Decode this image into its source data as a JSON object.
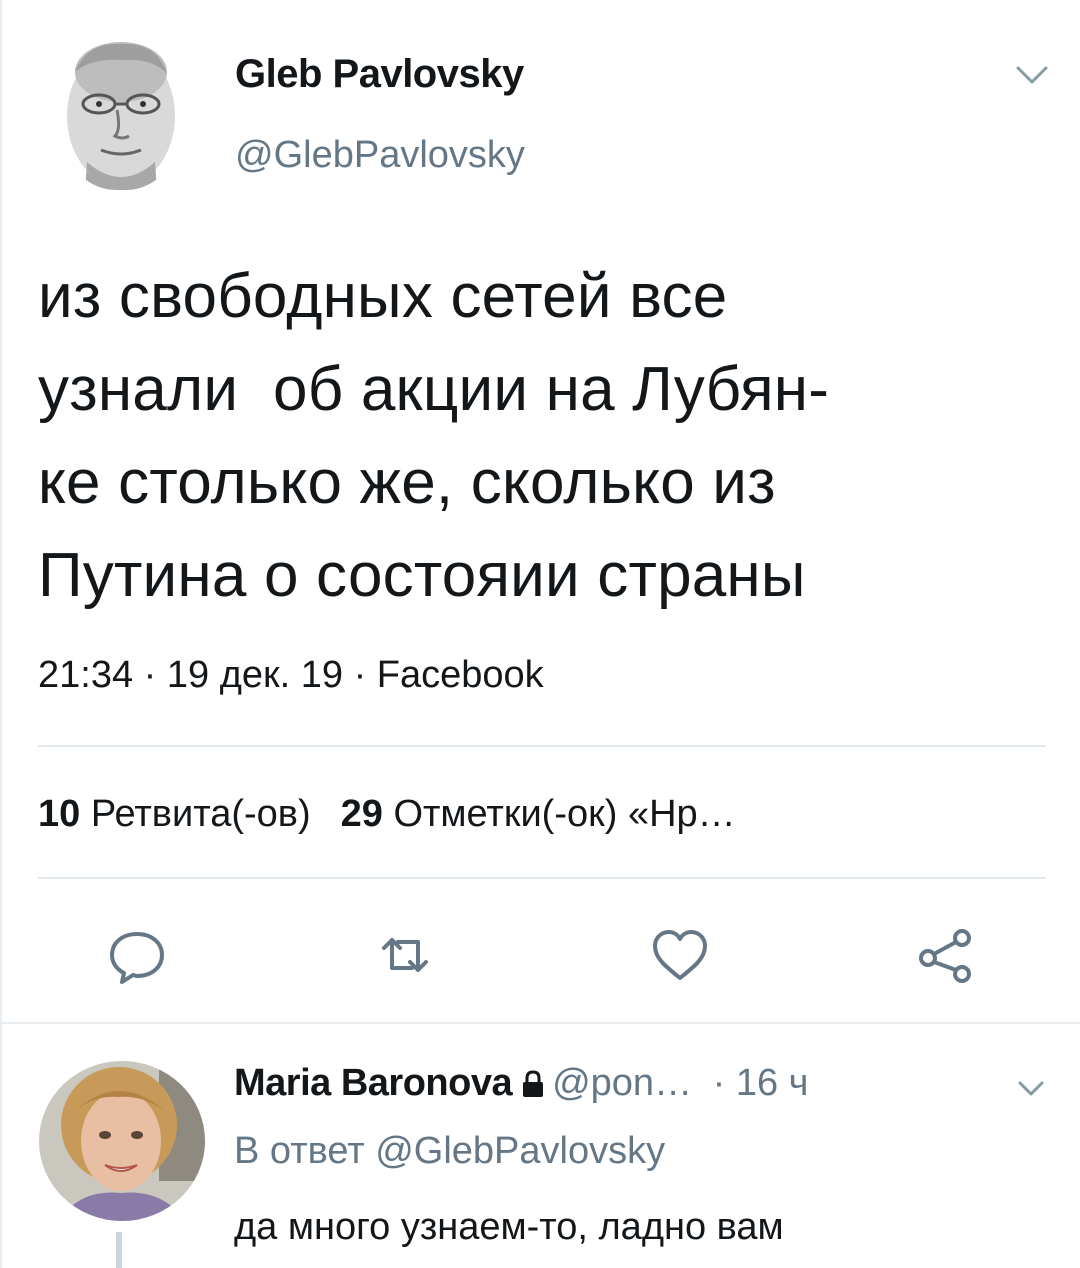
{
  "tweet": {
    "author_name": "Gleb Pavlovsky",
    "author_handle": "@GlebPavlovsky",
    "text": "из свободных сетей все\nузнали  об акции на Лубян-\nке столько же, сколько из\nПутина о состояии страны",
    "time": "21:34",
    "date": "19 дек. 19",
    "source": "Facebook",
    "meta_sep": " · ",
    "retweets_count": "10",
    "retweets_label": "Ретвита(-ов)",
    "likes_count": "29",
    "likes_label": "Отметки(-ок) «Нр…"
  },
  "actions": [
    {
      "icon": "reply-icon"
    },
    {
      "icon": "retweet-icon"
    },
    {
      "icon": "like-heart-icon"
    },
    {
      "icon": "share-icon"
    }
  ],
  "reply": {
    "author_name": "Maria Baronova",
    "author_handle": "@pon…",
    "time": "16 ч",
    "time_sep": " · ",
    "context_prefix": "В ответ",
    "context_handle": "@GlebPavlovsky",
    "text": "да много узнаем-то, ладно вам",
    "protected": true
  },
  "colors": {
    "text": "#14171a",
    "secondary": "#657786",
    "divider": "#e1e8ed",
    "icon": "#657786"
  }
}
